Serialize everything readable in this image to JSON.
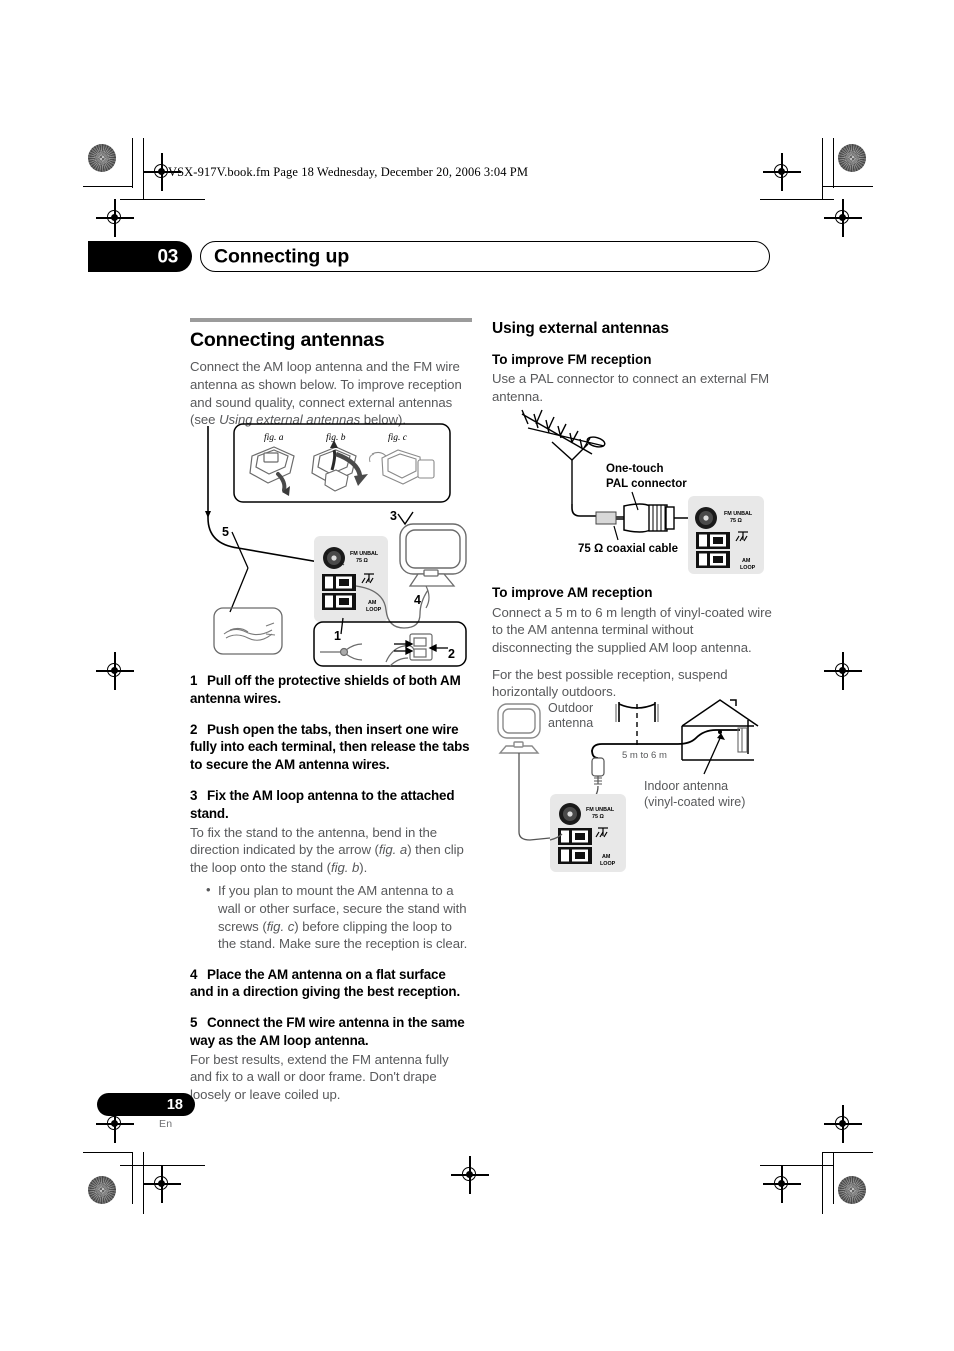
{
  "print_marks": {
    "file_header": "VSX-917V.book.fm  Page 18  Wednesday, December 20, 2006  3:04 PM"
  },
  "chapter": {
    "number": "03",
    "title": "Connecting up"
  },
  "left_column": {
    "section_title": "Connecting antennas",
    "intro_part1": "Connect the AM loop antenna and the FM wire antenna as shown below. To improve reception and sound quality, connect external antennas (see ",
    "intro_italic": "Using external antennas",
    "intro_part2": " below).",
    "steps": [
      {
        "number": "1",
        "heading": "Pull off the protective shields of both AM antenna wires."
      },
      {
        "number": "2",
        "heading": "Push open the tabs, then insert one wire fully into each terminal, then release the tabs to secure the AM antenna wires."
      },
      {
        "number": "3",
        "heading": "Fix the AM loop antenna to the attached stand.",
        "body_part1": "To fix the stand to the antenna, bend in the direction indicated by the arrow (",
        "body_italic1": "fig. a",
        "body_part2": ") then clip the loop onto the stand (",
        "body_italic2": "fig. b",
        "body_part3": ").",
        "bullet_part1": "If you plan to mount the AM antenna to a wall or other surface, secure the stand with screws (",
        "bullet_italic": "fig. c",
        "bullet_part2": ") before clipping the loop to the stand. Make sure the reception is clear."
      },
      {
        "number": "4",
        "heading": "Place the AM antenna on a flat surface and in a direction giving the best reception."
      },
      {
        "number": "5",
        "heading": "Connect the FM wire antenna in the same way as the AM loop antenna.",
        "body": "For best results, extend the FM antenna fully and fix to a wall or door frame. Don't drape loosely or leave coiled up."
      }
    ]
  },
  "right_column": {
    "section_title": "Using external antennas",
    "fm": {
      "heading": "To improve FM reception",
      "body": "Use a PAL connector to connect an external FM antenna."
    },
    "am": {
      "heading": "To improve AM reception",
      "body1": "Connect a 5 m to 6 m length of vinyl-coated wire to the AM antenna terminal without disconnecting the supplied AM loop antenna.",
      "body2": "For the best possible reception, suspend horizontally outdoors."
    }
  },
  "figures": {
    "main": {
      "fig_a_label": "fig. a",
      "fig_b_label": "fig. b",
      "fig_c_label": "fig. c",
      "callouts": [
        "1",
        "2",
        "3",
        "4",
        "5"
      ],
      "terminal_fm_label_line1": "FM UNBAL",
      "terminal_fm_label_line2": "75 Ω",
      "terminal_am_label_line1": "AM",
      "terminal_am_label_line2": "LOOP"
    },
    "fm_external": {
      "connector_label_line1": "One-touch",
      "connector_label_line2": "PAL connector",
      "cable_label": "75 Ω coaxial cable",
      "terminal_fm_label_line1": "FM UNBAL",
      "terminal_fm_label_line2": "75 Ω",
      "terminal_am_label_line1": "AM",
      "terminal_am_label_line2": "LOOP"
    },
    "am_external": {
      "outdoor_label_line1": "Outdoor",
      "outdoor_label_line2": "antenna",
      "length_label": "5 m to 6 m",
      "indoor_label_line1": "Indoor antenna",
      "indoor_label_line2": "(vinyl-coated wire)",
      "terminal_fm_label_line1": "FM UNBAL",
      "terminal_fm_label_line2": "75 Ω",
      "terminal_am_label_line1": "AM",
      "terminal_am_label_line2": "LOOP"
    }
  },
  "footer": {
    "page_number": "18",
    "language": "En"
  },
  "colors": {
    "body_text": "#58595b",
    "heading_text": "#000000",
    "rule": "#9b9b9b",
    "terminal_panel": "#e8e8e8"
  }
}
